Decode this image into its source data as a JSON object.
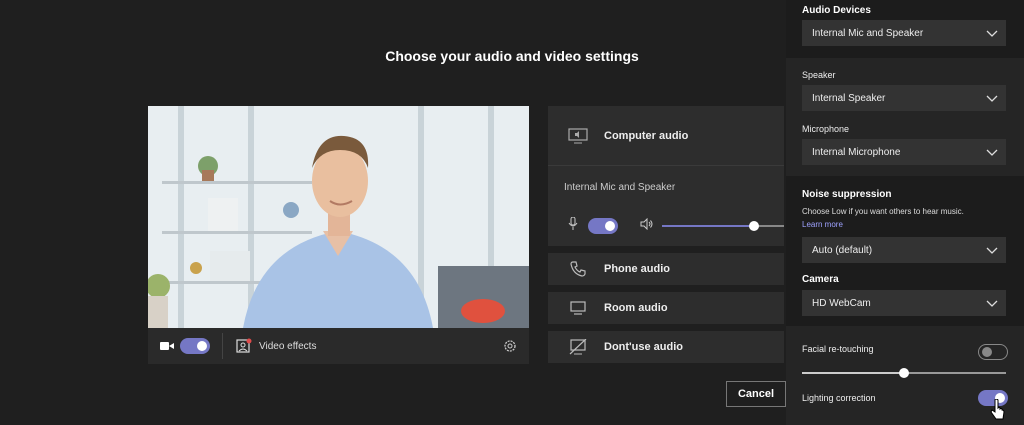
{
  "title": "Choose your audio and video settings",
  "video_bar": {
    "camera_on": true,
    "effects_label": "Video effects"
  },
  "audio_options": {
    "computer_audio": {
      "label": "Computer audio",
      "device": "Internal Mic and Speaker",
      "mic_on": true,
      "volume": 0.75
    },
    "phone_audio": "Phone audio",
    "room_audio": "Room audio",
    "dont_use_audio": "Dont'use audio"
  },
  "cancel_label": "Cancel",
  "panel": {
    "audio_devices_label": "Audio Devices",
    "audio_devices_value": "Internal Mic and Speaker",
    "speaker_label": "Speaker",
    "speaker_value": "Internal Speaker",
    "microphone_label": "Microphone",
    "microphone_value": "Internal Microphone",
    "noise_label": "Noise suppression",
    "noise_hint": "Choose Low if you want others to hear music.",
    "learn_more": "Learn more",
    "noise_value": "Auto (default)",
    "camera_label": "Camera",
    "camera_value": "HD WebCam",
    "facial_label": "Facial re-touching",
    "facial_on": false,
    "facial_level": 0.5,
    "lighting_label": "Lighting correction",
    "lighting_on": true
  },
  "colors": {
    "accent": "#7577c5",
    "background": "#1f1f1f",
    "panel": "#252525"
  }
}
